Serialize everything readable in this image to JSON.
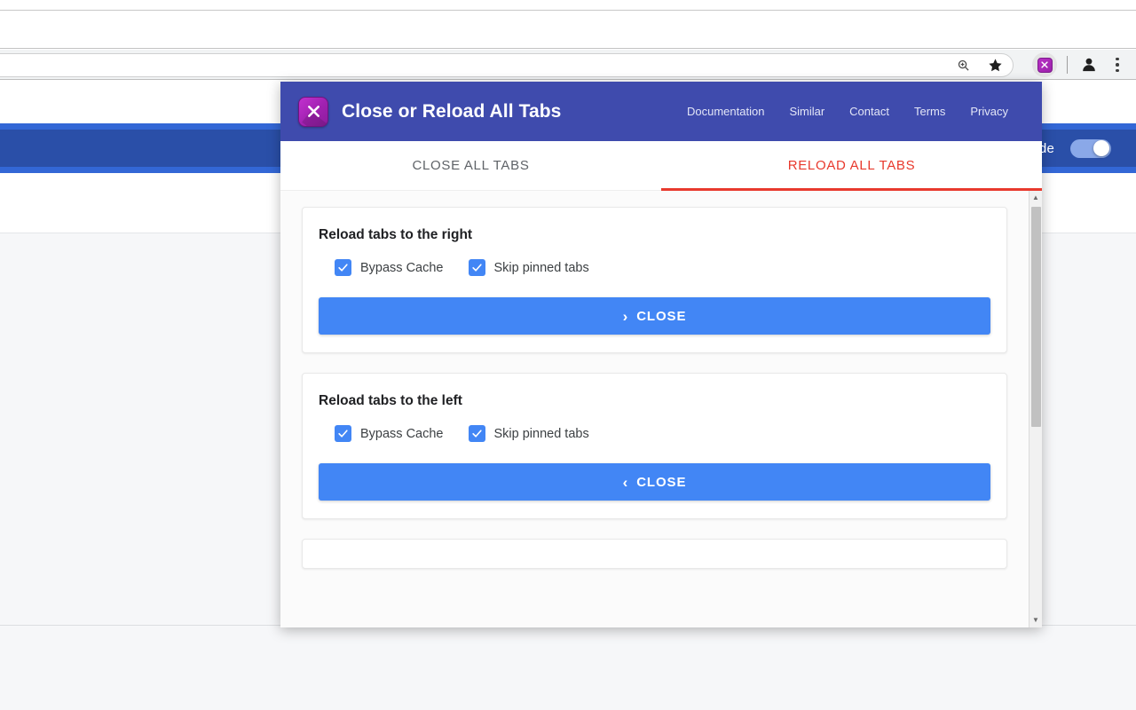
{
  "browser": {
    "omnibox": {
      "zoom_icon": "zoom-in-icon",
      "bookmark_icon": "star-icon"
    },
    "extension_button": {
      "icon": "x-extension-icon",
      "glyph": "✕"
    },
    "profile_icon": "profile-avatar-icon",
    "menu_icon": "three-dot-menu-icon"
  },
  "page": {
    "banner_label": "de",
    "toggle_state": "on"
  },
  "popup": {
    "brand": {
      "icon": "x-extension-icon",
      "title": "Close or Reload All Tabs"
    },
    "nav": [
      {
        "label": "Documentation"
      },
      {
        "label": "Similar"
      },
      {
        "label": "Contact"
      },
      {
        "label": "Terms"
      },
      {
        "label": "Privacy"
      }
    ],
    "tabs": [
      {
        "label": "CLOSE ALL TABS",
        "active": false
      },
      {
        "label": "RELOAD ALL TABS",
        "active": true
      }
    ],
    "cards": [
      {
        "title": "Reload tabs to the right",
        "options": [
          {
            "label": "Bypass Cache",
            "checked": true
          },
          {
            "label": "Skip pinned tabs",
            "checked": true
          }
        ],
        "button": {
          "chevron": "›",
          "label": "CLOSE"
        }
      },
      {
        "title": "Reload tabs to the left",
        "options": [
          {
            "label": "Bypass Cache",
            "checked": true
          },
          {
            "label": "Skip pinned tabs",
            "checked": true
          }
        ],
        "button": {
          "chevron": "‹",
          "label": "CLOSE"
        }
      }
    ],
    "scrollbar": {
      "up_arrow": "▲",
      "down_arrow": "▼"
    }
  },
  "colors": {
    "header_blue": "#3f4bad",
    "accent_red": "#e8392d",
    "button_blue": "#4286f5",
    "banner_blue": "#2a4fa8",
    "brand_purple": "#a021b0"
  }
}
